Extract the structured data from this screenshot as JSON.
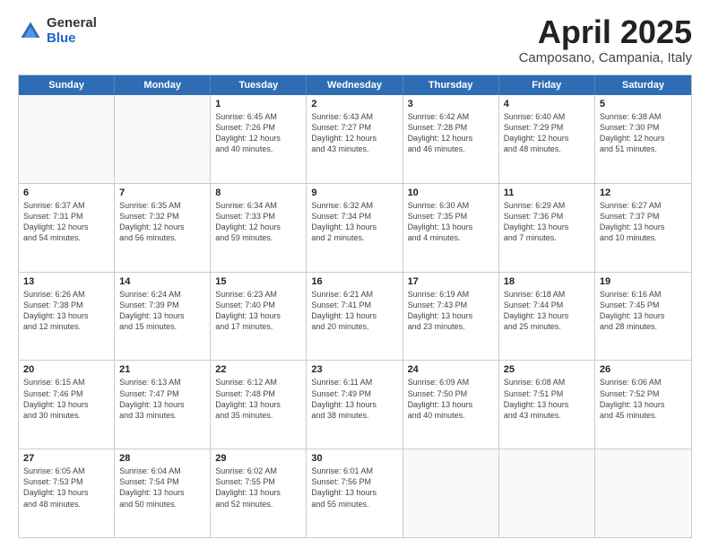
{
  "logo": {
    "general": "General",
    "blue": "Blue"
  },
  "title": {
    "month": "April 2025",
    "location": "Camposano, Campania, Italy"
  },
  "header": {
    "days": [
      "Sunday",
      "Monday",
      "Tuesday",
      "Wednesday",
      "Thursday",
      "Friday",
      "Saturday"
    ]
  },
  "weeks": [
    [
      {
        "day": "",
        "lines": []
      },
      {
        "day": "",
        "lines": []
      },
      {
        "day": "1",
        "lines": [
          "Sunrise: 6:45 AM",
          "Sunset: 7:26 PM",
          "Daylight: 12 hours",
          "and 40 minutes."
        ]
      },
      {
        "day": "2",
        "lines": [
          "Sunrise: 6:43 AM",
          "Sunset: 7:27 PM",
          "Daylight: 12 hours",
          "and 43 minutes."
        ]
      },
      {
        "day": "3",
        "lines": [
          "Sunrise: 6:42 AM",
          "Sunset: 7:28 PM",
          "Daylight: 12 hours",
          "and 46 minutes."
        ]
      },
      {
        "day": "4",
        "lines": [
          "Sunrise: 6:40 AM",
          "Sunset: 7:29 PM",
          "Daylight: 12 hours",
          "and 48 minutes."
        ]
      },
      {
        "day": "5",
        "lines": [
          "Sunrise: 6:38 AM",
          "Sunset: 7:30 PM",
          "Daylight: 12 hours",
          "and 51 minutes."
        ]
      }
    ],
    [
      {
        "day": "6",
        "lines": [
          "Sunrise: 6:37 AM",
          "Sunset: 7:31 PM",
          "Daylight: 12 hours",
          "and 54 minutes."
        ]
      },
      {
        "day": "7",
        "lines": [
          "Sunrise: 6:35 AM",
          "Sunset: 7:32 PM",
          "Daylight: 12 hours",
          "and 56 minutes."
        ]
      },
      {
        "day": "8",
        "lines": [
          "Sunrise: 6:34 AM",
          "Sunset: 7:33 PM",
          "Daylight: 12 hours",
          "and 59 minutes."
        ]
      },
      {
        "day": "9",
        "lines": [
          "Sunrise: 6:32 AM",
          "Sunset: 7:34 PM",
          "Daylight: 13 hours",
          "and 2 minutes."
        ]
      },
      {
        "day": "10",
        "lines": [
          "Sunrise: 6:30 AM",
          "Sunset: 7:35 PM",
          "Daylight: 13 hours",
          "and 4 minutes."
        ]
      },
      {
        "day": "11",
        "lines": [
          "Sunrise: 6:29 AM",
          "Sunset: 7:36 PM",
          "Daylight: 13 hours",
          "and 7 minutes."
        ]
      },
      {
        "day": "12",
        "lines": [
          "Sunrise: 6:27 AM",
          "Sunset: 7:37 PM",
          "Daylight: 13 hours",
          "and 10 minutes."
        ]
      }
    ],
    [
      {
        "day": "13",
        "lines": [
          "Sunrise: 6:26 AM",
          "Sunset: 7:38 PM",
          "Daylight: 13 hours",
          "and 12 minutes."
        ]
      },
      {
        "day": "14",
        "lines": [
          "Sunrise: 6:24 AM",
          "Sunset: 7:39 PM",
          "Daylight: 13 hours",
          "and 15 minutes."
        ]
      },
      {
        "day": "15",
        "lines": [
          "Sunrise: 6:23 AM",
          "Sunset: 7:40 PM",
          "Daylight: 13 hours",
          "and 17 minutes."
        ]
      },
      {
        "day": "16",
        "lines": [
          "Sunrise: 6:21 AM",
          "Sunset: 7:41 PM",
          "Daylight: 13 hours",
          "and 20 minutes."
        ]
      },
      {
        "day": "17",
        "lines": [
          "Sunrise: 6:19 AM",
          "Sunset: 7:43 PM",
          "Daylight: 13 hours",
          "and 23 minutes."
        ]
      },
      {
        "day": "18",
        "lines": [
          "Sunrise: 6:18 AM",
          "Sunset: 7:44 PM",
          "Daylight: 13 hours",
          "and 25 minutes."
        ]
      },
      {
        "day": "19",
        "lines": [
          "Sunrise: 6:16 AM",
          "Sunset: 7:45 PM",
          "Daylight: 13 hours",
          "and 28 minutes."
        ]
      }
    ],
    [
      {
        "day": "20",
        "lines": [
          "Sunrise: 6:15 AM",
          "Sunset: 7:46 PM",
          "Daylight: 13 hours",
          "and 30 minutes."
        ]
      },
      {
        "day": "21",
        "lines": [
          "Sunrise: 6:13 AM",
          "Sunset: 7:47 PM",
          "Daylight: 13 hours",
          "and 33 minutes."
        ]
      },
      {
        "day": "22",
        "lines": [
          "Sunrise: 6:12 AM",
          "Sunset: 7:48 PM",
          "Daylight: 13 hours",
          "and 35 minutes."
        ]
      },
      {
        "day": "23",
        "lines": [
          "Sunrise: 6:11 AM",
          "Sunset: 7:49 PM",
          "Daylight: 13 hours",
          "and 38 minutes."
        ]
      },
      {
        "day": "24",
        "lines": [
          "Sunrise: 6:09 AM",
          "Sunset: 7:50 PM",
          "Daylight: 13 hours",
          "and 40 minutes."
        ]
      },
      {
        "day": "25",
        "lines": [
          "Sunrise: 6:08 AM",
          "Sunset: 7:51 PM",
          "Daylight: 13 hours",
          "and 43 minutes."
        ]
      },
      {
        "day": "26",
        "lines": [
          "Sunrise: 6:06 AM",
          "Sunset: 7:52 PM",
          "Daylight: 13 hours",
          "and 45 minutes."
        ]
      }
    ],
    [
      {
        "day": "27",
        "lines": [
          "Sunrise: 6:05 AM",
          "Sunset: 7:53 PM",
          "Daylight: 13 hours",
          "and 48 minutes."
        ]
      },
      {
        "day": "28",
        "lines": [
          "Sunrise: 6:04 AM",
          "Sunset: 7:54 PM",
          "Daylight: 13 hours",
          "and 50 minutes."
        ]
      },
      {
        "day": "29",
        "lines": [
          "Sunrise: 6:02 AM",
          "Sunset: 7:55 PM",
          "Daylight: 13 hours",
          "and 52 minutes."
        ]
      },
      {
        "day": "30",
        "lines": [
          "Sunrise: 6:01 AM",
          "Sunset: 7:56 PM",
          "Daylight: 13 hours",
          "and 55 minutes."
        ]
      },
      {
        "day": "",
        "lines": []
      },
      {
        "day": "",
        "lines": []
      },
      {
        "day": "",
        "lines": []
      }
    ]
  ]
}
